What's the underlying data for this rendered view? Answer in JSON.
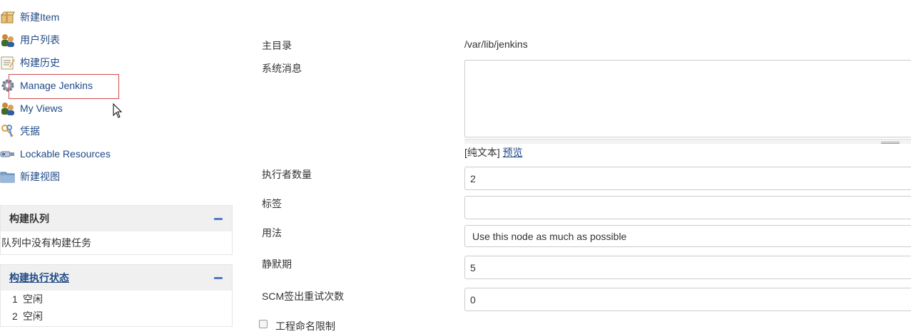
{
  "sidebar": {
    "tasks": [
      {
        "label": "新建Item",
        "icon": "new-package-icon"
      },
      {
        "label": "用户列表",
        "icon": "users-icon"
      },
      {
        "label": "构建历史",
        "icon": "notepad-icon"
      },
      {
        "label": "Manage Jenkins",
        "icon": "gear-icon"
      },
      {
        "label": "My Views",
        "icon": "users-icon"
      },
      {
        "label": "凭据",
        "icon": "keys-icon"
      },
      {
        "label": "Lockable Resources",
        "icon": "usb-lock-icon"
      },
      {
        "label": "新建视图",
        "icon": "folder-icon"
      }
    ],
    "build_queue": {
      "title": "构建队列",
      "empty_text": "队列中没有构建任务"
    },
    "executor_status": {
      "title": "构建执行状态",
      "executors": [
        {
          "number": "1",
          "state": "空闲"
        },
        {
          "number": "2",
          "state": "空闲"
        }
      ]
    }
  },
  "config": {
    "home_dir": {
      "label": "主目录",
      "value": "/var/lib/jenkins"
    },
    "system_message": {
      "label": "系统消息",
      "value": "",
      "markup_prefix": "[纯文本]",
      "preview_link": "预览"
    },
    "executors": {
      "label": "执行者数量",
      "value": "2"
    },
    "labels": {
      "label": "标签",
      "value": ""
    },
    "usage": {
      "label": "用法",
      "value": "Use this node as much as possible"
    },
    "quiet_period": {
      "label": "静默期",
      "value": "5"
    },
    "scm_retry": {
      "label": "SCM签出重试次数",
      "value": "0"
    },
    "name_restriction": {
      "label": "工程命名限制",
      "checked": false
    }
  },
  "colors": {
    "link": "#204a87",
    "highlight_border": "#d24b4b",
    "pane_header_bg": "#f0f0f0"
  }
}
